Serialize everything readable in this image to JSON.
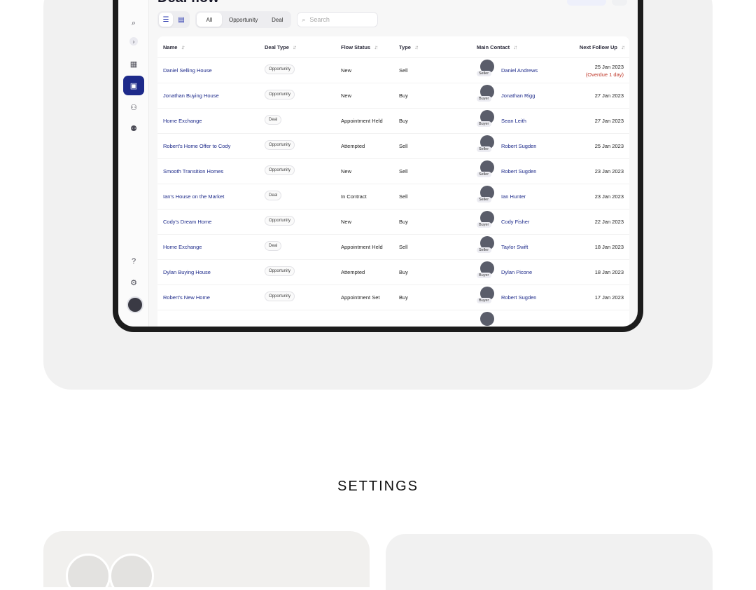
{
  "app": {
    "title": "Deal flow"
  },
  "toolbar": {
    "view_icons": [
      "list-icon",
      "cards-icon"
    ],
    "filters": [
      {
        "label": "All",
        "selected": true
      },
      {
        "label": "Opportunity",
        "selected": false
      },
      {
        "label": "Deal",
        "selected": false
      }
    ],
    "search_placeholder": "Search"
  },
  "sidebar": {
    "items": [
      {
        "icon": "search-icon",
        "glyph": "⌕",
        "active": false
      },
      {
        "icon": "chevron-right-icon",
        "glyph": "›",
        "active": false
      },
      {
        "icon": "dashboard-icon",
        "glyph": "▦",
        "active": false
      },
      {
        "icon": "briefcase-icon",
        "glyph": "▣",
        "active": true
      },
      {
        "icon": "contact-icon",
        "glyph": "⚇",
        "active": false
      },
      {
        "icon": "users-icon",
        "glyph": "⚉",
        "active": false
      }
    ],
    "bottom_items": [
      {
        "icon": "help-icon",
        "glyph": "?"
      },
      {
        "icon": "settings-icon",
        "glyph": "⚙"
      }
    ]
  },
  "table": {
    "columns": [
      "Name",
      "Deal Type",
      "Flow Status",
      "Type",
      "Main Contact",
      "Next Follow Up"
    ],
    "rows": [
      {
        "name": "Daniel Selling House",
        "deal_type": "Opportunity",
        "flow_status": "New",
        "type": "Sell",
        "contact": "Daniel Andrews",
        "role": "Seller",
        "date": "25 Jan 2023",
        "note": "(Overdue 1 day)"
      },
      {
        "name": "Jonathan Buying House",
        "deal_type": "Opportunity",
        "flow_status": "New",
        "type": "Buy",
        "contact": "Jonathan Rigg",
        "role": "Buyer",
        "date": "27 Jan 2023"
      },
      {
        "name": "Home Exchange",
        "deal_type": "Deal",
        "flow_status": "Appointment Held",
        "type": "Buy",
        "contact": "Sean Leith",
        "role": "Buyer",
        "date": "27 Jan 2023"
      },
      {
        "name": "Robert's Home Offer to Cody",
        "deal_type": "Opportunity",
        "flow_status": "Attempted",
        "type": "Sell",
        "contact": "Robert Sugden",
        "role": "Seller",
        "date": "25 Jan 2023"
      },
      {
        "name": "Smooth Transition Homes",
        "deal_type": "Opportunity",
        "flow_status": "New",
        "type": "Sell",
        "contact": "Robert Sugden",
        "role": "Seller",
        "date": "23 Jan 2023"
      },
      {
        "name": "Ian's House on the Market",
        "deal_type": "Deal",
        "flow_status": "In Contract",
        "type": "Sell",
        "contact": "Ian Hunter",
        "role": "Seller",
        "date": "23 Jan 2023"
      },
      {
        "name": "Cody's Dream Home",
        "deal_type": "Opportunity",
        "flow_status": "New",
        "type": "Buy",
        "contact": "Cody Fisher",
        "role": "Buyer",
        "date": "22 Jan 2023"
      },
      {
        "name": "Home Exchange",
        "deal_type": "Deal",
        "flow_status": "Appointment Held",
        "type": "Sell",
        "contact": "Taylor Swift",
        "role": "Seller",
        "date": "18 Jan 2023"
      },
      {
        "name": "Dylan Buying House",
        "deal_type": "Opportunity",
        "flow_status": "Attempted",
        "type": "Buy",
        "contact": "Dylan Picone",
        "role": "Buyer",
        "date": "18 Jan 2023"
      },
      {
        "name": "Robert's New Home",
        "deal_type": "Opportunity",
        "flow_status": "Appointment Set",
        "type": "Buy",
        "contact": "Robert Sugden",
        "role": "Buyer",
        "date": "17 Jan 2023"
      }
    ]
  },
  "section": {
    "heading": "SETTINGS"
  }
}
